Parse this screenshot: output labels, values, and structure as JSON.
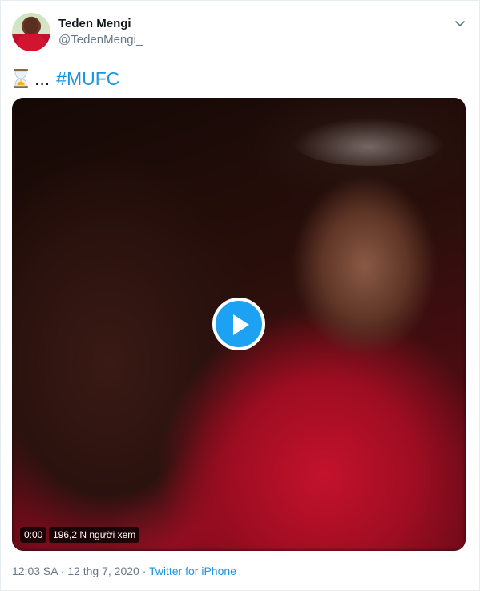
{
  "author": {
    "name": "Teden Mengi",
    "handle": "@TedenMengi_",
    "avatar_icon": "profile-photo"
  },
  "tweet": {
    "emoji_icon": "hourglass-icon",
    "ellipsis": "...",
    "hashtag": "#MUFC"
  },
  "video": {
    "time": "0:00",
    "views": "196,2 N người xem",
    "play_icon": "play-icon"
  },
  "meta": {
    "time": "12:03 SA",
    "separator1": " · ",
    "date": "12 thg 7, 2020",
    "separator2": " · ",
    "source": "Twitter for iPhone"
  },
  "colors": {
    "accent": "#1da1f2",
    "link": "#1b95e0",
    "secondary_text": "#657786"
  }
}
